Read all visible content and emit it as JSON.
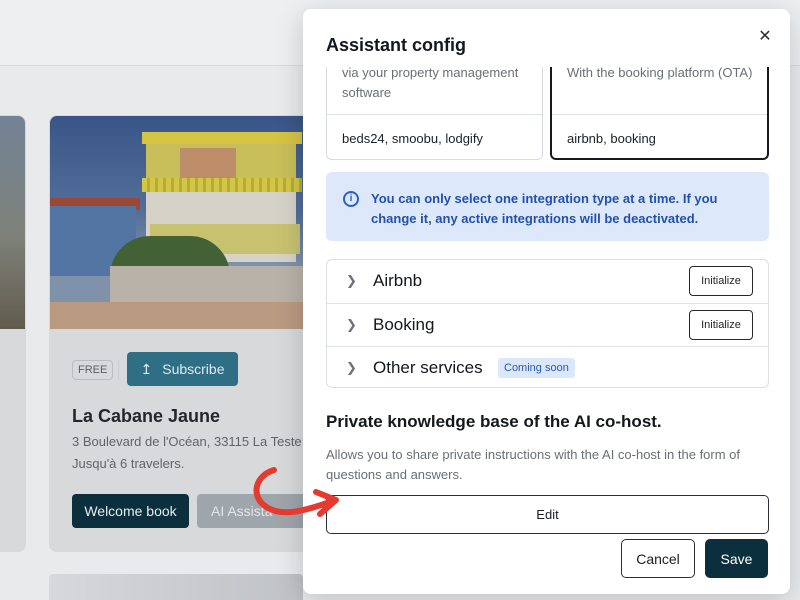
{
  "background": {
    "card": {
      "free_badge": "FREE",
      "subscribe_label": "Subscribe",
      "title": "La Cabane Jaune",
      "address": "3 Boulevard de l'Océan, 33115 La Teste",
      "travelers": "Jusqu'à 6 travelers.",
      "welcome_book_label": "Welcome book",
      "ai_assistant_label": "AI Assista"
    }
  },
  "modal": {
    "title": "Assistant config",
    "integrations": [
      {
        "description": "via your property management software",
        "platforms": "beds24, smoobu, lodgify",
        "selected": false
      },
      {
        "description": "With the booking platform (OTA)",
        "platforms": "airbnb, booking",
        "selected": true
      }
    ],
    "info_icon": "info-icon",
    "info_text": "You can only select one integration type at a time. If you change it, any active integrations will be deactivated.",
    "services": [
      {
        "label": "Airbnb",
        "action": "Initialize"
      },
      {
        "label": "Booking",
        "action": "Initialize"
      },
      {
        "label": "Other services",
        "badge": "Coming soon"
      }
    ],
    "knowledge_base": {
      "title": "Private knowledge base of the AI co-host.",
      "description": "Allows you to share private instructions with the AI co-host in the form of questions and answers.",
      "edit_label": "Edit"
    },
    "footer": {
      "cancel_label": "Cancel",
      "save_label": "Save"
    }
  },
  "colors": {
    "primary_dark": "#0c2f3d",
    "info_bg": "#dde9fb",
    "info_text": "#2350ad",
    "annotation_arrow": "#e53a2f"
  }
}
